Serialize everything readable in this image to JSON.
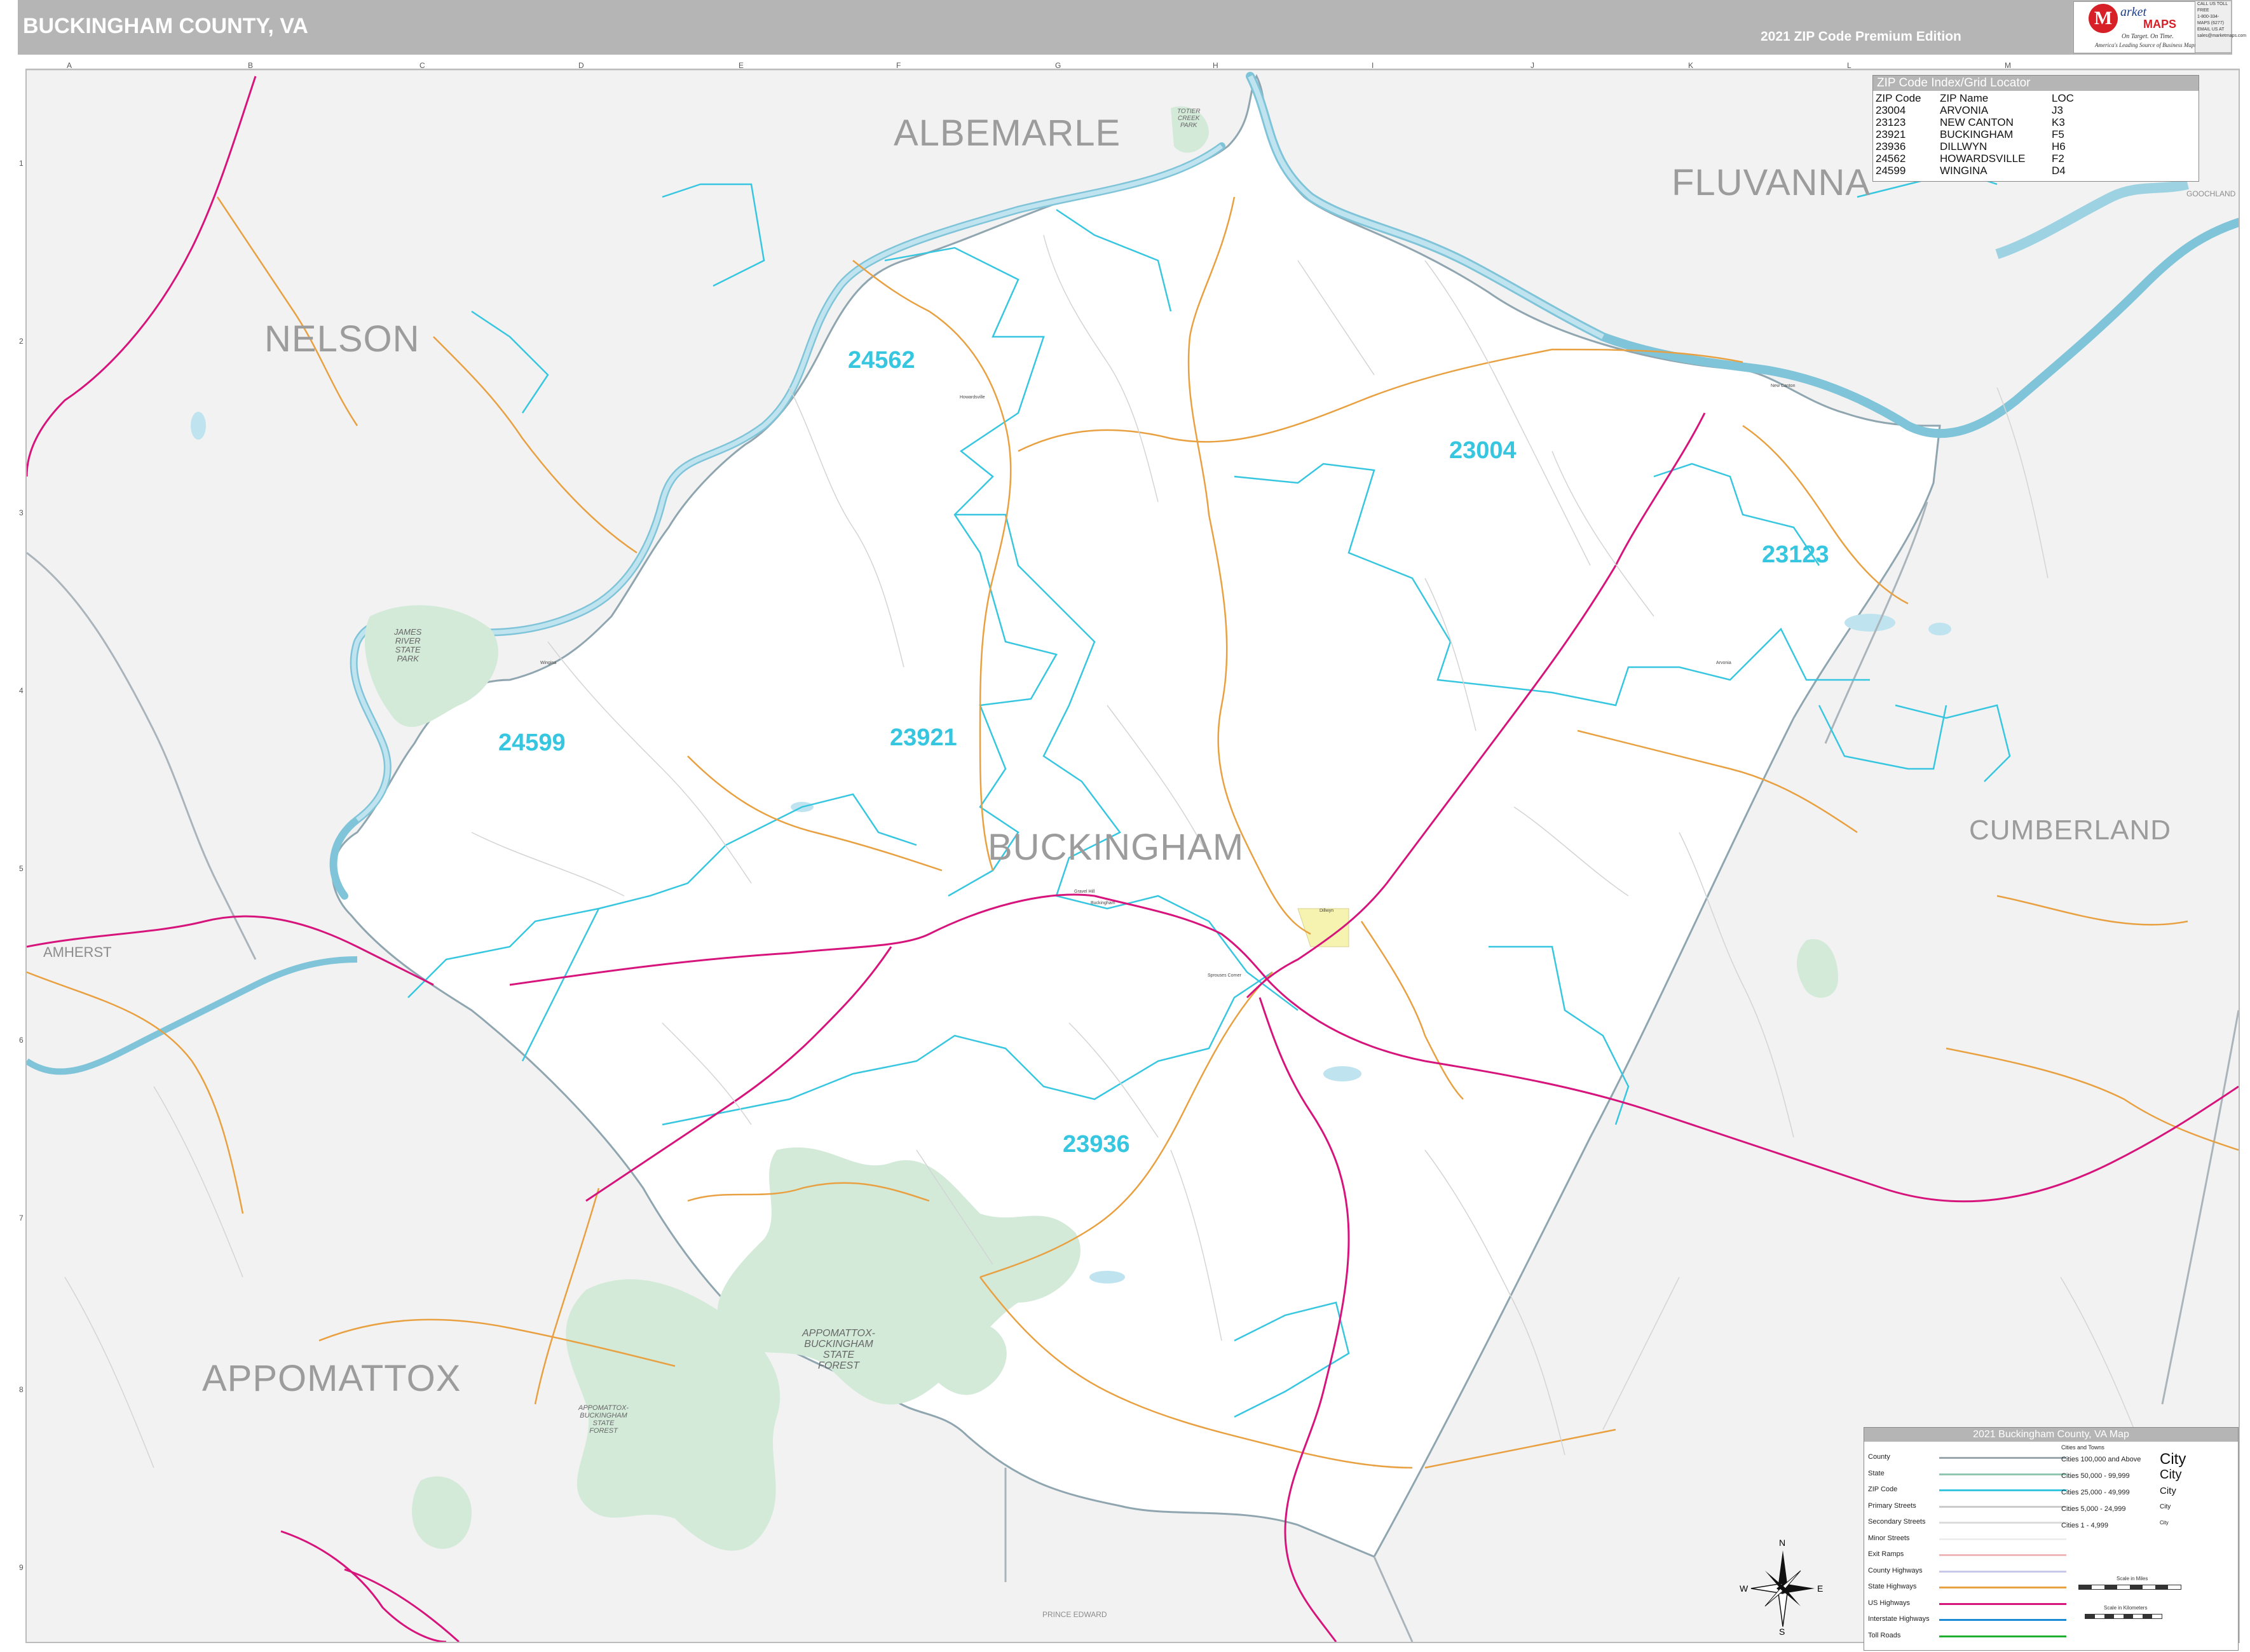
{
  "header": {
    "title": "BUCKINGHAM COUNTY, VA",
    "edition": "2021 ZIP Code Premium Edition"
  },
  "logo": {
    "letter": "M",
    "word1": "arket",
    "word2": "MAPS",
    "tagline1": "On Target. On Time.",
    "tagline2": "America's Leading Source of Business Maps"
  },
  "contact": {
    "line1": "CALL US TOLL FREE",
    "line2": "1-800-334-MAPS (6277)",
    "line3": "EMAIL US AT",
    "line4": "sales@marketmaps.com"
  },
  "grid": {
    "columns": [
      "A",
      "B",
      "C",
      "D",
      "E",
      "F",
      "G",
      "H",
      "I",
      "J",
      "K",
      "L",
      "M"
    ],
    "rows": [
      "1",
      "2",
      "3",
      "4",
      "5",
      "6",
      "7",
      "8",
      "9"
    ]
  },
  "counties": {
    "albemarle": "ALBEMARLE",
    "fluvanna": "FLUVANNA",
    "nelson": "NELSON",
    "buckingham": "BUCKINGHAM",
    "cumberland": "CUMBERLAND",
    "amherst": "AMHERST",
    "appomattox": "APPOMATTOX",
    "prince_edward": "PRINCE EDWARD",
    "goochland": "GOOCHLAND"
  },
  "zips": {
    "z24562": "24562",
    "z23004": "23004",
    "z23123": "23123",
    "z24599": "24599",
    "z23921": "23921",
    "z23936": "23936"
  },
  "places": {
    "p1": "Arvonia",
    "p2": "Dillwyn",
    "p3": "Wingina",
    "p4": "New Canton",
    "p5": "Buckingham",
    "p6": "Howardsville",
    "p7": "Sprouses Corner",
    "p8": "Gravel Hill"
  },
  "parks": {
    "james_river": "JAMES\nRIVER\nSTATE\nPARK",
    "appomattox_buckingham": "APPOMATTOX-\nBUCKINGHAM\nSTATE\nFOREST",
    "appomattox_buckingham_2": "APPOMATTOX-\nBUCKINGHAM\nSTATE\nFOREST",
    "totier_creek": "TOTIER\nCREEK\nPARK"
  },
  "zip_index": {
    "title": "ZIP Code Index/Grid Locator",
    "headers": [
      "ZIP Code",
      "ZIP Name",
      "LOC"
    ],
    "rows": [
      [
        "23004",
        "ARVONIA",
        "J3"
      ],
      [
        "23123",
        "NEW CANTON",
        "K3"
      ],
      [
        "23921",
        "BUCKINGHAM",
        "F5"
      ],
      [
        "23936",
        "DILLWYN",
        "H6"
      ],
      [
        "24562",
        "HOWARDSVILLE",
        "F2"
      ],
      [
        "24599",
        "WINGINA",
        "D4"
      ]
    ]
  },
  "legend": {
    "title": "2021 Buckingham County, VA Map",
    "cities_header": "Cities and Towns",
    "items": [
      {
        "label": "County",
        "color": "#9aa7ad"
      },
      {
        "label": "State",
        "color": "#8fc7b0"
      },
      {
        "label": "ZIP Code",
        "color": "#37c6e0"
      },
      {
        "label": "Primary Streets",
        "color": "#cccccc"
      },
      {
        "label": "Secondary Streets",
        "color": "#dddddd"
      },
      {
        "label": "Minor Streets",
        "color": "#eeeeee"
      },
      {
        "label": "Exit Ramps",
        "color": "#f0b8b8"
      },
      {
        "label": "County Highways",
        "color": "#c8c8e8"
      },
      {
        "label": "State Highways",
        "color": "#e8a040"
      },
      {
        "label": "US Highways",
        "color": "#d6147c"
      },
      {
        "label": "Interstate Highways",
        "color": "#1a8ad6"
      },
      {
        "label": "Toll Roads",
        "color": "#20b030"
      }
    ],
    "cities": [
      {
        "label": "Cities 100,000 and Above",
        "sample": "City"
      },
      {
        "label": "Cities 50,000 - 99,999",
        "sample": "City"
      },
      {
        "label": "Cities 25,000 - 49,999",
        "sample": "City"
      },
      {
        "label": "Cities 5,000 - 24,999",
        "sample": "City"
      },
      {
        "label": "Cities 1 - 4,999",
        "sample": "City"
      }
    ],
    "scale_miles": "Scale in Miles",
    "scale_km": "Scale in Kilometers"
  },
  "compass": {
    "n": "N",
    "s": "S",
    "e": "E",
    "w": "W"
  },
  "colors": {
    "header_bg": "#b5b5b5",
    "water": "#bfe4ef",
    "water_edge": "#6cb5cc",
    "zip_boundary": "#37c6e0",
    "us_highway": "#d6147c",
    "state_highway": "#e8a040",
    "park": "#d3ead9",
    "outside": "#f2f2f2"
  }
}
